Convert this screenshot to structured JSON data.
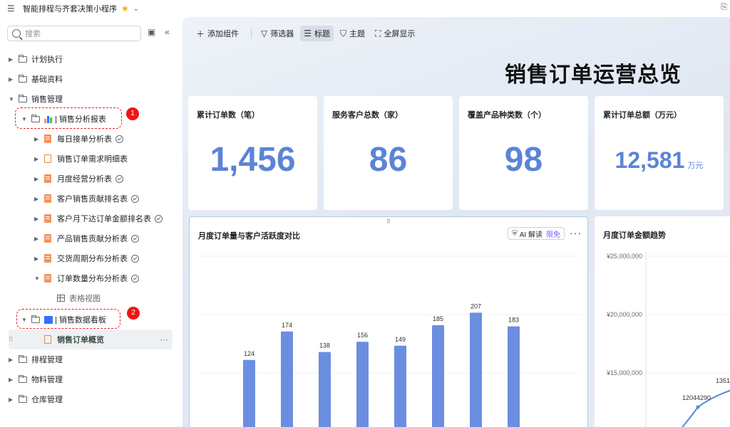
{
  "topbar": {
    "title": "智能排程与齐套决策小程序"
  },
  "sidebar": {
    "search_placeholder": "搜索",
    "items": [
      {
        "label": "计划执行"
      },
      {
        "label": "基础资料"
      },
      {
        "label": "销售管理"
      },
      {
        "label": "| 销售分析报表"
      },
      {
        "label": "每日接单分析表"
      },
      {
        "label": "销售订单需求明细表"
      },
      {
        "label": "月度经营分析表"
      },
      {
        "label": "客户销售贡献排名表"
      },
      {
        "label": "客户月下达订单金额排名表"
      },
      {
        "label": "产品销售贡献分析表"
      },
      {
        "label": "交货周期分布分析表"
      },
      {
        "label": "订单数量分布分析表"
      },
      {
        "label": "表格视图"
      },
      {
        "label": "| 销售数据看板"
      },
      {
        "label": "销售订单概览"
      },
      {
        "label": "排程管理"
      },
      {
        "label": "物料管理"
      },
      {
        "label": "仓库管理"
      }
    ],
    "badges": [
      "1",
      "2"
    ]
  },
  "toolbar": {
    "add": "添加组件",
    "filter": "筛选器",
    "title_btn": "标题",
    "theme": "主题",
    "fullscreen": "全屏显示"
  },
  "dashboard": {
    "title": "销售订单运营总览",
    "kpis": [
      {
        "label": "累计订单数（笔）",
        "value": "1,456"
      },
      {
        "label": "服务客户总数（家）",
        "value": "86"
      },
      {
        "label": "覆盖产品种类数（个）",
        "value": "98"
      },
      {
        "label": "累计订单总额（万元）",
        "value": "12,581",
        "unit": "万元"
      }
    ],
    "panel1": {
      "title": "月度订单量与客户活跃度对比",
      "ai_label": "AI 解读",
      "ai_free": "限免"
    },
    "panel2": {
      "title": "月度订单金额趋势"
    }
  },
  "chart_data": [
    {
      "type": "bar",
      "title": "月度订单量与客户活跃度对比",
      "values": [
        124,
        174,
        138,
        156,
        149,
        185,
        207,
        183
      ],
      "labels": [
        "124",
        "174",
        "138",
        "156",
        "149",
        "185",
        "207",
        "183"
      ],
      "color": "#6b8ee0"
    },
    {
      "type": "line",
      "title": "月度订单金额趋势",
      "y_ticks": [
        "¥25,000,000",
        "¥20,000,000",
        "¥15,000,000"
      ],
      "point_labels": [
        "12044290",
        "1351"
      ],
      "color": "#5b84d6"
    }
  ]
}
